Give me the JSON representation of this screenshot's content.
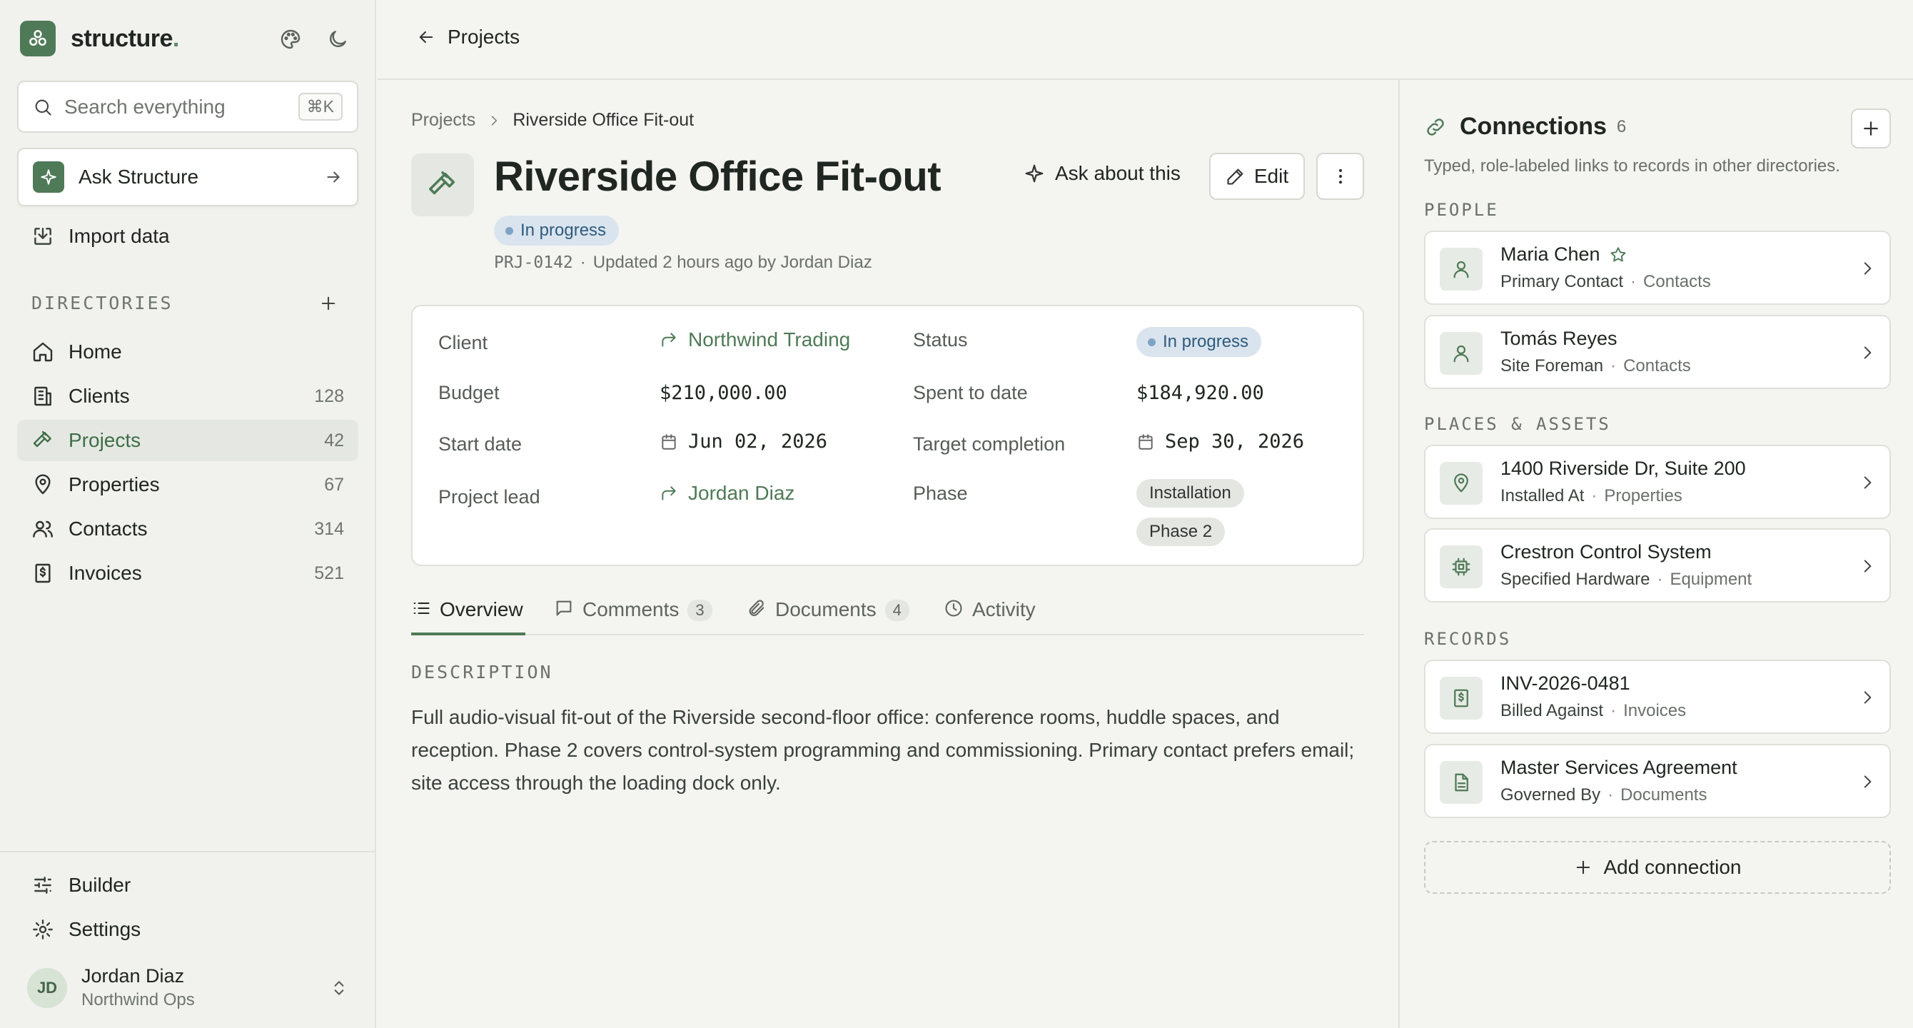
{
  "sidebar": {
    "brand": {
      "name": "structure",
      "dot": "."
    },
    "search": {
      "placeholder": "Search everything",
      "shortcut": "⌘K"
    },
    "ask": {
      "label": "Ask Structure"
    },
    "import": {
      "label": "Import data"
    },
    "directories_title": "DIRECTORIES",
    "nav": [
      {
        "label": "Home",
        "count": "",
        "icon": "home-icon"
      },
      {
        "label": "Clients",
        "count": "128",
        "icon": "building-icon"
      },
      {
        "label": "Projects",
        "count": "42",
        "icon": "hammer-icon",
        "active": true
      },
      {
        "label": "Properties",
        "count": "67",
        "icon": "map-pin-icon"
      },
      {
        "label": "Contacts",
        "count": "314",
        "icon": "users-icon"
      },
      {
        "label": "Invoices",
        "count": "521",
        "icon": "invoice-icon"
      }
    ],
    "builder": "Builder",
    "settings": "Settings",
    "user": {
      "initials": "JD",
      "name": "Jordan Diaz",
      "org": "Northwind Ops"
    }
  },
  "topbar": {
    "back_label": "Projects"
  },
  "main": {
    "breadcrumb": {
      "parent": "Projects",
      "current": "Riverside Office Fit-out"
    },
    "title": "Riverside Office Fit-out",
    "status": "In progress",
    "meta": {
      "id": "PRJ-0142",
      "sep": "·",
      "updated": "Updated 2 hours ago by Jordan Diaz"
    },
    "actions": {
      "ask": "Ask about this",
      "edit": "Edit"
    },
    "fields": {
      "client_label": "Client",
      "client": "Northwind Trading",
      "status_label": "Status",
      "status": "In progress",
      "budget_label": "Budget",
      "budget": "$210,000.00",
      "spent_label": "Spent to date",
      "spent": "$184,920.00",
      "start_label": "Start date",
      "start": "Jun 02, 2026",
      "target_label": "Target completion",
      "target": "Sep 30, 2026",
      "lead_label": "Project lead",
      "lead": "Jordan Diaz",
      "phase_label": "Phase",
      "phases": [
        "Installation",
        "Phase 2"
      ]
    },
    "tabs": [
      {
        "label": "Overview",
        "count": ""
      },
      {
        "label": "Comments",
        "count": "3"
      },
      {
        "label": "Documents",
        "count": "4"
      },
      {
        "label": "Activity",
        "count": ""
      }
    ],
    "description_title": "DESCRIPTION",
    "description": "Full audio-visual fit-out of the Riverside second-floor office: conference rooms, huddle spaces, and reception. Phase 2 covers control-system programming and commissioning. Primary contact prefers email; site access through the loading dock only."
  },
  "connections": {
    "title": "Connections",
    "count": "6",
    "subtitle": "Typed, role-labeled links to records in other directories.",
    "sections": {
      "people": "PEOPLE",
      "places": "PLACES & ASSETS",
      "records": "RECORDS"
    },
    "items": [
      {
        "name": "Maria Chen",
        "role": "Primary Contact",
        "dir": "Contacts"
      },
      {
        "name": "Tomás Reyes",
        "role": "Site Foreman",
        "dir": "Contacts"
      },
      {
        "name": "1400 Riverside Dr, Suite 200",
        "role": "Installed At",
        "dir": "Properties"
      },
      {
        "name": "Crestron Control System",
        "role": "Specified Hardware",
        "dir": "Equipment"
      },
      {
        "name": "INV-2026-0481",
        "role": "Billed Against",
        "dir": "Invoices"
      },
      {
        "name": "Master Services Agreement",
        "role": "Governed By",
        "dir": "Documents"
      }
    ],
    "dot_sep": "·",
    "add_label": "Add connection"
  },
  "colors": {
    "accent": "#4f7a57",
    "status_bg": "#d9e4ee",
    "status_text": "#2f5a7e",
    "background": "#f4f4f1"
  }
}
